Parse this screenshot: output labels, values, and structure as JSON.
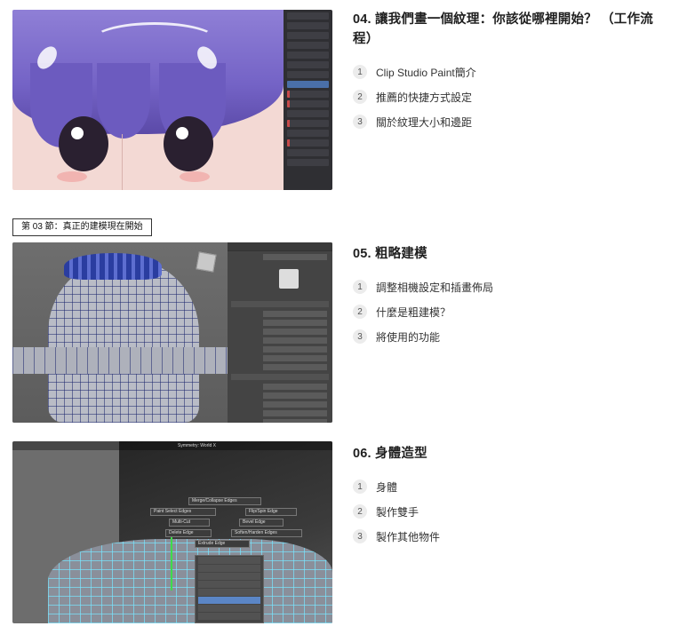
{
  "lessons": [
    {
      "title": "04. 讓我們畫一個紋理：你該從哪裡開始？ （工作流程）",
      "items": [
        {
          "num": "1",
          "label": "Clip Studio Paint簡介"
        },
        {
          "num": "2",
          "label": "推薦的快捷方式設定"
        },
        {
          "num": "3",
          "label": "關於紋理大小和邊距"
        }
      ]
    },
    {
      "title": "05. 粗略建模",
      "items": [
        {
          "num": "1",
          "label": "調整相機設定和插畫佈局"
        },
        {
          "num": "2",
          "label": "什麼是粗建模？"
        },
        {
          "num": "3",
          "label": "將使用的功能"
        }
      ]
    },
    {
      "title": "06. 身體造型",
      "items": [
        {
          "num": "1",
          "label": "身體"
        },
        {
          "num": "2",
          "label": "製作雙手"
        },
        {
          "num": "3",
          "label": "製作其他物件"
        }
      ]
    }
  ],
  "section_badge": "第 03 節：真正的建模現在開始",
  "thumbnails": {
    "t3_menu": {
      "merge": "Merge/Collapse Edges",
      "paint_select": "Paint Select Edges",
      "flip_spin": "Flip/Spin Edge",
      "multi_cut": "Multi-Cut",
      "bevel": "Bevel Edge",
      "delete": "Delete Edge",
      "soften": "Soften/Harden Edges",
      "extrude": "Extrude Edge",
      "symmetry": "Symmetry: World X"
    }
  }
}
